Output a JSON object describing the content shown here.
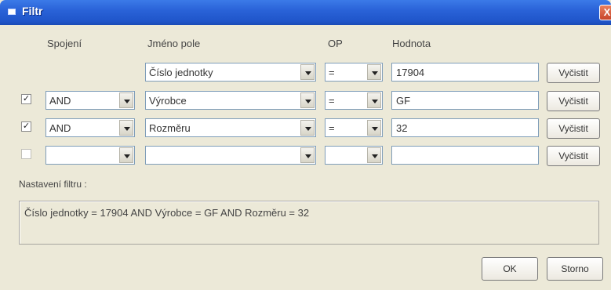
{
  "window": {
    "title": "Filtr",
    "close_glyph": "X"
  },
  "headers": {
    "spojeni": "Spojení",
    "field": "Jméno pole",
    "op": "OP",
    "value": "Hodnota"
  },
  "rows": [
    {
      "checked": null,
      "join": "",
      "field": "Číslo jednotky",
      "op": "=",
      "value": "17904",
      "clear": "Vyčistit"
    },
    {
      "checked": true,
      "join": "AND",
      "field": "Výrobce",
      "op": "=",
      "value": "GF",
      "clear": "Vyčistit"
    },
    {
      "checked": true,
      "join": "AND",
      "field": "Rozměru",
      "op": "=",
      "value": "32",
      "clear": "Vyčistit"
    },
    {
      "checked": false,
      "join": "",
      "field": "",
      "op": "",
      "value": "",
      "clear": "Vyčistit"
    }
  ],
  "settings": {
    "label": "Nastavení filtru :",
    "summary": "Číslo jednotky = 17904 AND Výrobce = GF AND Rozměru = 32"
  },
  "buttons": {
    "ok": "OK",
    "cancel": "Storno"
  },
  "icons": {
    "check": "✓",
    "dropdown": "chevron-down-icon"
  },
  "colors": {
    "titlebar": "#2a63d8",
    "dialog_bg": "#ece9d8",
    "field_border": "#7f9db9"
  }
}
